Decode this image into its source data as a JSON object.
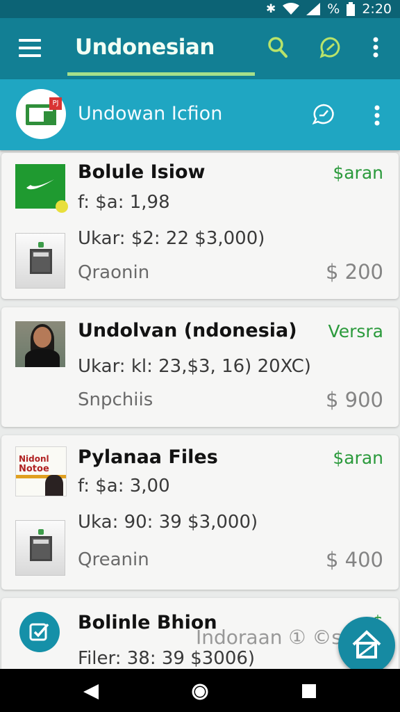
{
  "status_bar": {
    "time": "2:20",
    "icons": [
      "bluetooth-icon",
      "wifi-icon",
      "signal-icon",
      "battery-icon"
    ],
    "battery_label": "%"
  },
  "app_bar": {
    "title": "Undonesian",
    "actions": [
      "search-icon",
      "chat-icon",
      "more-vert-icon"
    ],
    "accent": "#a6e08a",
    "background": "#127f94"
  },
  "sub_header": {
    "title": "Undowan Icfion",
    "badge": "PJ",
    "background": "#1fa6c2"
  },
  "cards": [
    {
      "title": "Bolule Isiow",
      "tag": "$aran",
      "line1": "f: $a: 1,98",
      "line2": "Ukar: $2: 22 $3,000)",
      "subtitle": "Qraonin",
      "price": "$ 200"
    },
    {
      "title": "Undolvan (ndonesia)",
      "tag": "Versra",
      "line1": "Ukar: kl: 23,$3, 16) 20XC)",
      "subtitle": "Snpchiis",
      "price": "$ 900"
    },
    {
      "title": "Pylanaa Files",
      "tag": "$aran",
      "line1": "f: $a: 3,00",
      "line2": "Uka: 90: 39 $3,000)",
      "subtitle": "Qreanin",
      "price": "$ 400",
      "poster_text": [
        "Nidonl",
        "Notoe"
      ]
    },
    {
      "title": "Bolinle Bhion",
      "tag": "$",
      "line1": "Filer: 38: 39 $3006)"
    }
  ],
  "watermark": "Indoraan ① ©s",
  "fab": {
    "icon": "home-icon"
  },
  "nav_bar": [
    "back-icon",
    "home-circle-icon",
    "recents-icon"
  ],
  "colors": {
    "tag_green": "#2b9a3c",
    "price_gray": "#848484"
  }
}
